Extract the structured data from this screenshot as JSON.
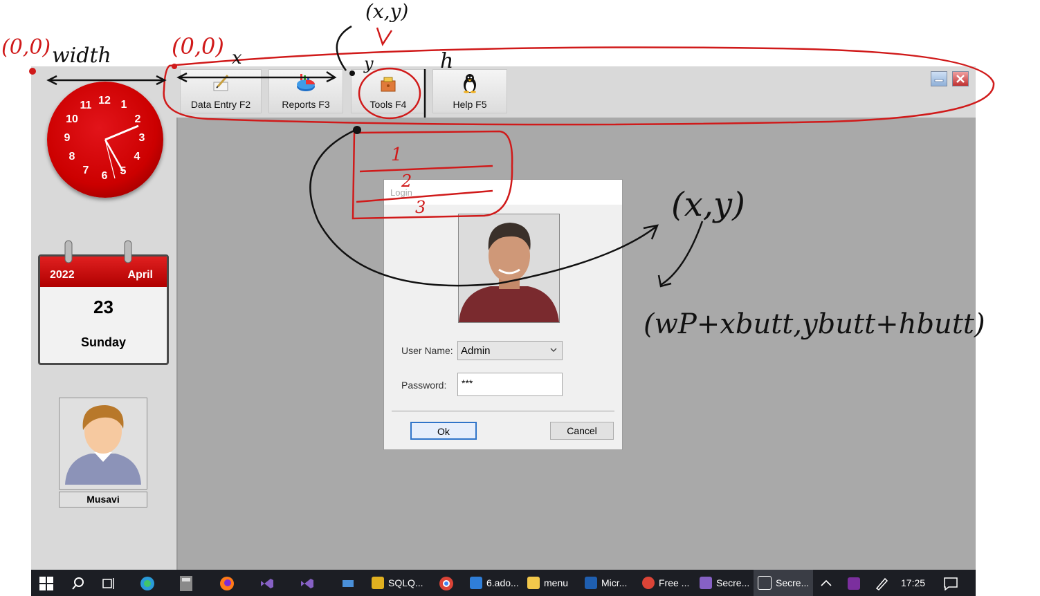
{
  "toolbar": {
    "buttons": [
      {
        "label": "Data Entry F2",
        "icon": "pen-edit-icon"
      },
      {
        "label": "Reports F3",
        "icon": "pie-chart-icon"
      },
      {
        "label": "Tools F4",
        "icon": "toolbox-icon"
      },
      {
        "label": "Help F5",
        "icon": "penguin-icon"
      }
    ],
    "minimize_icon": "minimize-icon",
    "close_icon": "close-icon"
  },
  "clock": {
    "numbers": [
      "1",
      "2",
      "3",
      "4",
      "5",
      "6",
      "7",
      "8",
      "9",
      "10",
      "11",
      "12"
    ],
    "time": "17:25"
  },
  "calendar": {
    "year": "2022",
    "month": "April",
    "day": "23",
    "weekday": "Sunday"
  },
  "user": {
    "name": "Musavi",
    "avatar_icon": "user-avatar-icon"
  },
  "login": {
    "title": "Login",
    "username_label": "User Name:",
    "username_value": "Admin",
    "password_label": "Password:",
    "password_value": "***",
    "ok_label": "Ok",
    "cancel_label": "Cancel"
  },
  "annotations": {
    "origin_left": "(0,0)",
    "width_label": "width",
    "origin_toolbar": "(0,0)",
    "x_label": "x",
    "xy_top": "(x,y)",
    "y_label": "y",
    "h_label": "h",
    "item_1": "1",
    "item_2": "2",
    "item_3": "3",
    "xy_right": "(x,y)",
    "formula": "(wP+xbutt,ybutt+hbutt)"
  },
  "taskbar": {
    "items": [
      "SQLQ...",
      "6.ado...",
      "menu",
      "Micr...",
      "Free ...",
      "Secre...",
      "Secre..."
    ],
    "time": "17:25"
  }
}
